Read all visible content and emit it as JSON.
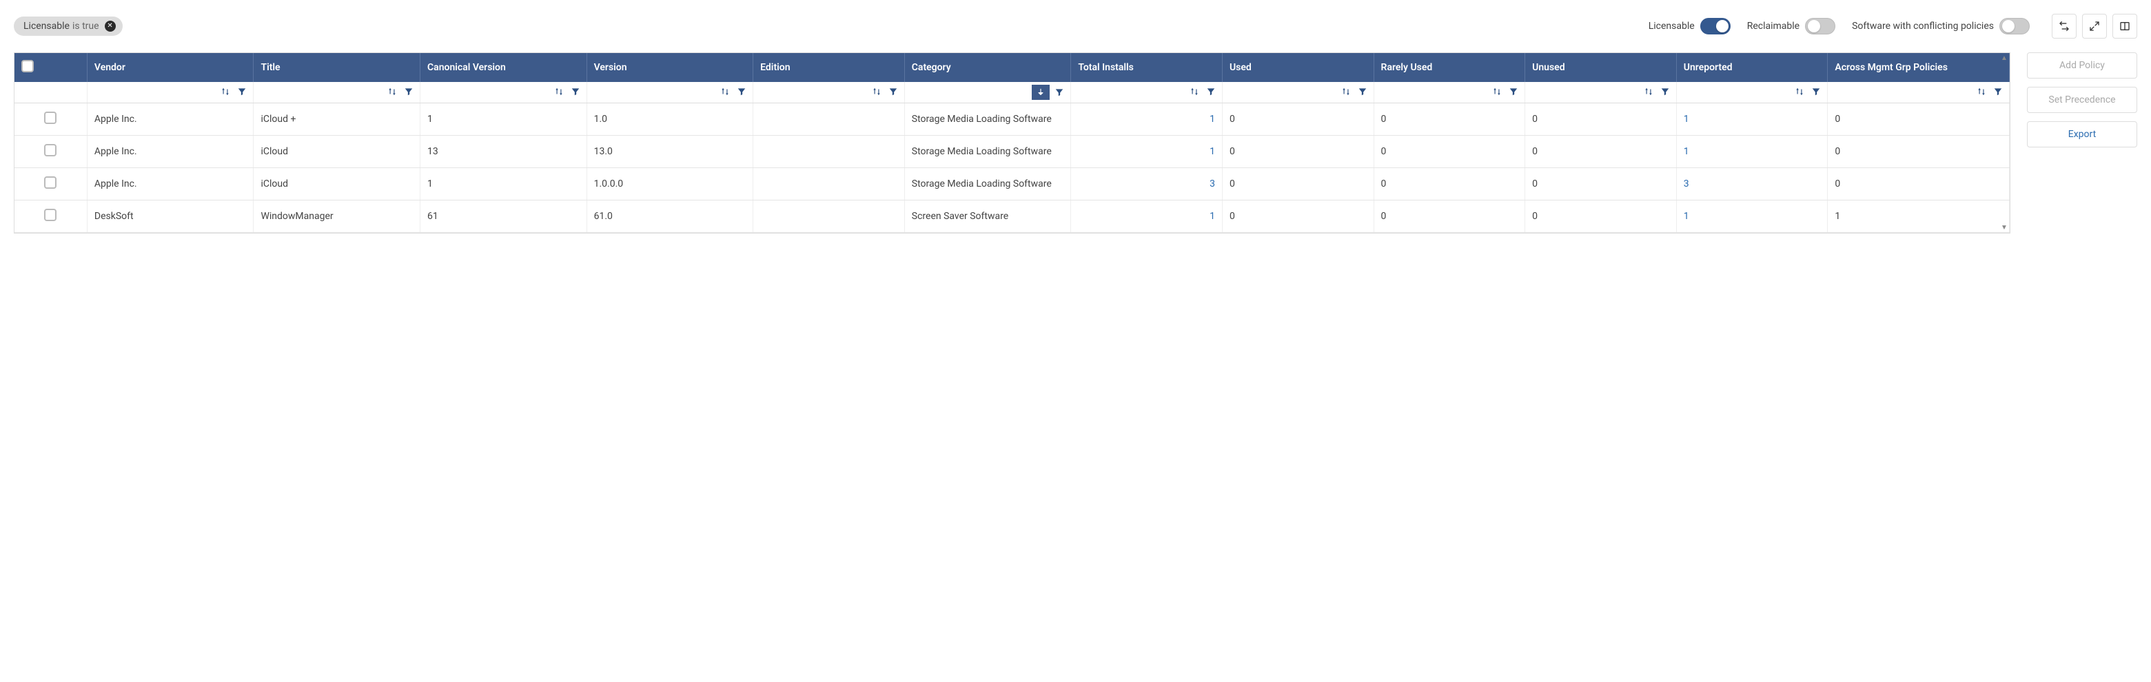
{
  "filter_chip": {
    "label": "Licensable",
    "value": "is true"
  },
  "toggles": {
    "licensable": {
      "label": "Licensable",
      "on": true
    },
    "reclaimable": {
      "label": "Reclaimable",
      "on": false
    },
    "conflicting": {
      "label": "Software with conflicting policies",
      "on": false
    }
  },
  "columns": [
    {
      "key": "vendor",
      "label": "Vendor"
    },
    {
      "key": "title",
      "label": "Title"
    },
    {
      "key": "canonical_version",
      "label": "Canonical Version"
    },
    {
      "key": "version",
      "label": "Version"
    },
    {
      "key": "edition",
      "label": "Edition"
    },
    {
      "key": "category",
      "label": "Category"
    },
    {
      "key": "total_installs",
      "label": "Total Installs"
    },
    {
      "key": "used",
      "label": "Used"
    },
    {
      "key": "rarely_used",
      "label": "Rarely Used"
    },
    {
      "key": "unused",
      "label": "Unused"
    },
    {
      "key": "unreported",
      "label": "Unreported"
    },
    {
      "key": "policies",
      "label": "Across Mgmt Grp Policies"
    }
  ],
  "rows": [
    {
      "vendor": "Apple Inc.",
      "title": "iCloud +",
      "canonical_version": "1",
      "version": "1.0",
      "edition": "",
      "category": "Storage Media Loading Software",
      "total_installs": "1",
      "used": "0",
      "rarely_used": "0",
      "unused": "0",
      "unreported": "1",
      "policies": "0"
    },
    {
      "vendor": "Apple Inc.",
      "title": "iCloud",
      "canonical_version": "13",
      "version": "13.0",
      "edition": "",
      "category": "Storage Media Loading Software",
      "total_installs": "1",
      "used": "0",
      "rarely_used": "0",
      "unused": "0",
      "unreported": "1",
      "policies": "0"
    },
    {
      "vendor": "Apple Inc.",
      "title": "iCloud",
      "canonical_version": "1",
      "version": "1.0.0.0",
      "edition": "",
      "category": "Storage Media Loading Software",
      "total_installs": "3",
      "used": "0",
      "rarely_used": "0",
      "unused": "0",
      "unreported": "3",
      "policies": "0"
    },
    {
      "vendor": "DeskSoft",
      "title": "WindowManager",
      "canonical_version": "61",
      "version": "61.0",
      "edition": "",
      "category": "Screen Saver Software",
      "total_installs": "1",
      "used": "0",
      "rarely_used": "0",
      "unused": "0",
      "unreported": "1",
      "policies": "1"
    }
  ],
  "side_buttons": {
    "add_policy": "Add Policy",
    "set_precedence": "Set Precedence",
    "export": "Export"
  }
}
